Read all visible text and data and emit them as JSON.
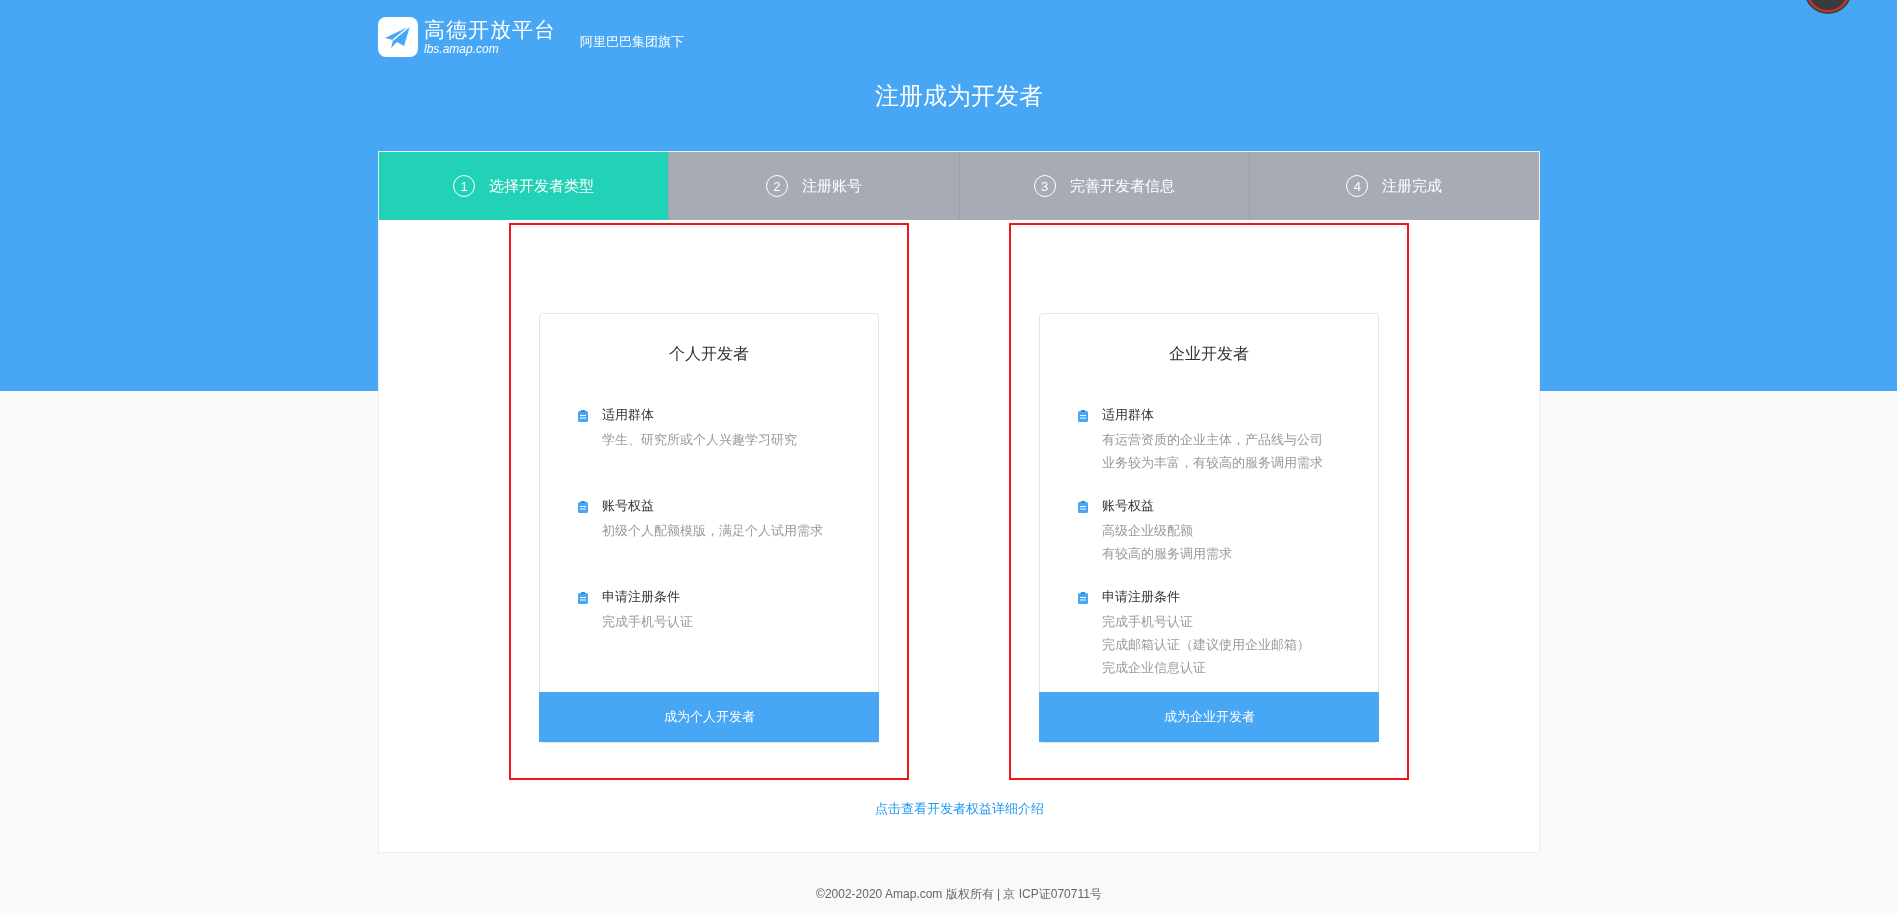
{
  "header": {
    "logo_text": "高德开放平台",
    "logo_subtext": "lbs.amap.com",
    "tagline": "阿里巴巴集团旗下",
    "title": "注册成为开发者"
  },
  "steps": [
    {
      "number": "1",
      "label": "选择开发者类型",
      "selected": true
    },
    {
      "number": "2",
      "label": "注册账号",
      "selected": false
    },
    {
      "number": "3",
      "label": "完善开发者信息",
      "selected": false
    },
    {
      "number": "4",
      "label": "注册完成",
      "selected": false
    }
  ],
  "cards": [
    {
      "title": "个人开发者",
      "highlighted": true,
      "button": "成为个人开发者",
      "sections": [
        {
          "heading": "适用群体",
          "lines": [
            "学生、研究所或个人兴趣学习研究"
          ]
        },
        {
          "heading": "账号权益",
          "lines": [
            "初级个人配额模版，满足个人试用需求"
          ]
        },
        {
          "heading": "申请注册条件",
          "lines": [
            "完成手机号认证"
          ]
        }
      ]
    },
    {
      "title": "企业开发者",
      "highlighted": true,
      "button": "成为企业开发者",
      "sections": [
        {
          "heading": "适用群体",
          "lines": [
            "有运营资质的企业主体，产品线与公司",
            "业务较为丰富，有较高的服务调用需求"
          ]
        },
        {
          "heading": "账号权益",
          "lines": [
            "高级企业级配额",
            "有较高的服务调用需求"
          ]
        },
        {
          "heading": "申请注册条件",
          "lines": [
            "完成手机号认证",
            "完成邮箱认证（建议使用企业邮箱）",
            "完成企业信息认证"
          ]
        }
      ]
    }
  ],
  "details_link": "点击查看开发者权益详细介绍",
  "footer": "©2002-2020 Amap.com 版权所有 | 京 ICP证070711号"
}
